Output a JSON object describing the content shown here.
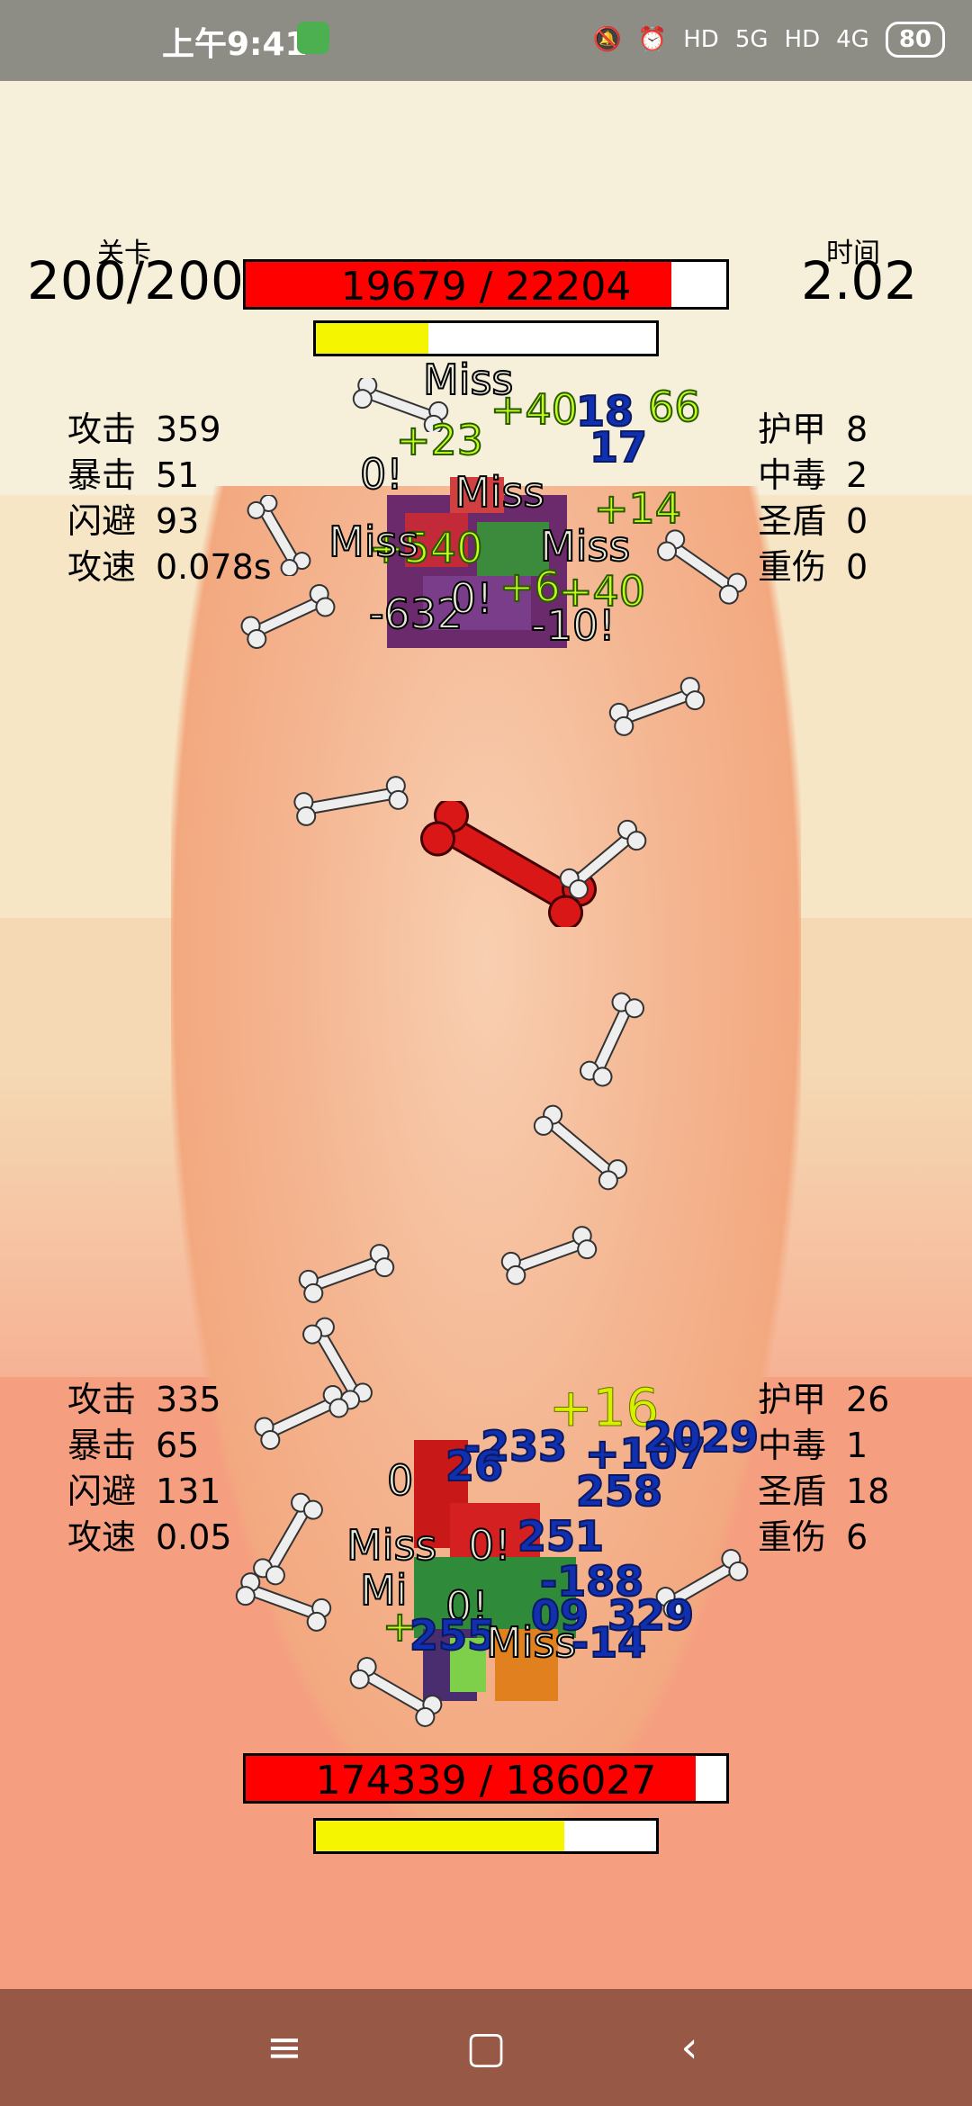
{
  "status_bar": {
    "time": "上午9:41",
    "battery": "80",
    "net1": "5G",
    "net2": "4G",
    "hd1": "HD",
    "hd2": "HD"
  },
  "colors": {
    "hp_fill": "#ff0000",
    "energy_fill": "#f5f500",
    "bone": "#efefef",
    "bone_red": "#d91717",
    "nav": "#985846"
  },
  "hud": {
    "level_label": "关卡",
    "level_value": "200/200",
    "time_label": "时间",
    "time_value": "2.02"
  },
  "enemy": {
    "hp_text": "19679 / 22204",
    "hp": 19679,
    "hp_max": 22204,
    "energy_fraction": 0.33,
    "stats_left": [
      {
        "k": "攻击",
        "v": "359"
      },
      {
        "k": "暴击",
        "v": "51"
      },
      {
        "k": "闪避",
        "v": "93"
      },
      {
        "k": "攻速",
        "v": "0.078s"
      }
    ],
    "stats_right": [
      {
        "k": "护甲",
        "v": "8"
      },
      {
        "k": "中毒",
        "v": "2"
      },
      {
        "k": "圣盾",
        "v": "0"
      },
      {
        "k": "重伤",
        "v": "0"
      }
    ]
  },
  "player": {
    "hp_text": "174339 / 186027",
    "hp": 174339,
    "hp_max": 186027,
    "energy_fraction": 0.73,
    "stats_left": [
      {
        "k": "攻击",
        "v": "335"
      },
      {
        "k": "暴击",
        "v": "65"
      },
      {
        "k": "闪避",
        "v": "131"
      },
      {
        "k": "攻速",
        "v": "0.05"
      }
    ],
    "stats_right": [
      {
        "k": "护甲",
        "v": "26"
      },
      {
        "k": "中毒",
        "v": "1"
      },
      {
        "k": "圣盾",
        "v": "18"
      },
      {
        "k": "重伤",
        "v": "6"
      }
    ]
  },
  "floaters_top": [
    {
      "t": "Miss",
      "c": "miss"
    },
    {
      "t": "+40",
      "c": "heal"
    },
    {
      "t": "18",
      "c": "dmg"
    },
    {
      "t": "66",
      "c": "heal"
    },
    {
      "t": "+23",
      "c": "heal"
    },
    {
      "t": "17",
      "c": "dmg"
    },
    {
      "t": "0!",
      "c": "miss"
    },
    {
      "t": "Miss",
      "c": "miss"
    },
    {
      "t": "+14",
      "c": "heal"
    },
    {
      "t": "+540",
      "c": "heal"
    },
    {
      "t": "Miss",
      "c": "miss"
    },
    {
      "t": "Miss",
      "c": "miss"
    },
    {
      "t": "+6",
      "c": "heal"
    },
    {
      "t": "+40",
      "c": "heal"
    },
    {
      "t": "-632",
      "c": "miss"
    },
    {
      "t": "0!",
      "c": "miss"
    },
    {
      "t": "-10!",
      "c": "miss"
    }
  ],
  "floaters_bottom": [
    {
      "t": "+16",
      "c": "yellow"
    },
    {
      "t": "-233",
      "c": "dmg"
    },
    {
      "t": "+107",
      "c": "dmg"
    },
    {
      "t": "2029",
      "c": "dmg"
    },
    {
      "t": "26",
      "c": "dmg"
    },
    {
      "t": "0",
      "c": "miss"
    },
    {
      "t": "258",
      "c": "dmg"
    },
    {
      "t": "Miss",
      "c": "miss"
    },
    {
      "t": "0!",
      "c": "miss"
    },
    {
      "t": "251",
      "c": "dmg"
    },
    {
      "t": "-188",
      "c": "dmg"
    },
    {
      "t": "Mi",
      "c": "miss"
    },
    {
      "t": "0!",
      "c": "miss"
    },
    {
      "t": "09",
      "c": "dmg"
    },
    {
      "t": "329",
      "c": "dmg"
    },
    {
      "t": "+",
      "c": "heal"
    },
    {
      "t": "255",
      "c": "dmg"
    },
    {
      "t": "Miss",
      "c": "miss"
    },
    {
      "t": "-14",
      "c": "dmg"
    }
  ],
  "nav": {
    "menu": "≡",
    "home": "▢",
    "back": "‹"
  }
}
